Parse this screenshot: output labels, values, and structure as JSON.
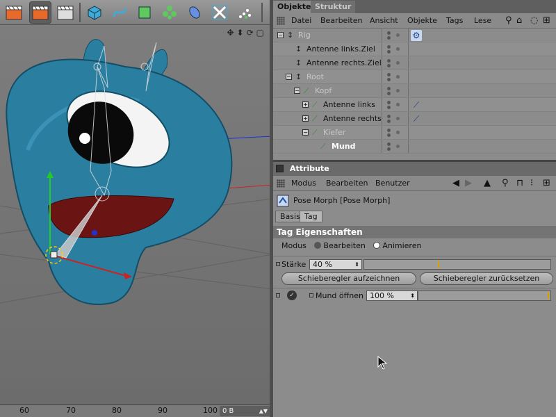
{
  "toolbar": {
    "icons": [
      "clapper-icon",
      "clapper-render-icon",
      "clapper-settings-icon",
      "cube-icon",
      "spline-icon",
      "nurbs-icon",
      "array-icon",
      "deformer-icon",
      "scene-icon",
      "particles-icon"
    ]
  },
  "timeline": {
    "ticks": [
      "60",
      "70",
      "80",
      "90",
      "100"
    ],
    "frame_value": "0 B"
  },
  "objects_panel": {
    "tabs": [
      "Objekte",
      "Struktur"
    ],
    "menu": [
      "Datei",
      "Bearbeiten",
      "Ansicht",
      "Objekte",
      "Tags",
      "Lese"
    ],
    "tree": [
      {
        "name": "Rig",
        "level": 0,
        "expander": "−",
        "style": "dim",
        "tag": "pose-morph-tag"
      },
      {
        "name": "Antenne links.Ziel",
        "level": 1,
        "expander": "",
        "style": "normal",
        "tag": ""
      },
      {
        "name": "Antenne rechts.Ziel",
        "level": 1,
        "expander": "",
        "style": "normal",
        "tag": ""
      },
      {
        "name": "Root",
        "level": 1,
        "expander": "−",
        "style": "dim",
        "tag": ""
      },
      {
        "name": "Kopf",
        "level": 2,
        "expander": "−",
        "style": "dim",
        "tag": ""
      },
      {
        "name": "Antenne links",
        "level": 3,
        "expander": "+",
        "style": "normal",
        "tag": "ik-tag"
      },
      {
        "name": "Antenne rechts",
        "level": 3,
        "expander": "+",
        "style": "normal",
        "tag": "ik-tag"
      },
      {
        "name": "Kiefer",
        "level": 3,
        "expander": "−",
        "style": "dim",
        "tag": ""
      },
      {
        "name": "Mund",
        "level": 4,
        "expander": "",
        "style": "bold",
        "tag": ""
      }
    ]
  },
  "attributes": {
    "title": "Attribute",
    "menu": [
      "Modus",
      "Bearbeiten",
      "Benutzer"
    ],
    "tag_title": "Pose Morph [Pose Morph]",
    "subtabs": [
      "Basis",
      "Tag"
    ],
    "section": "Tag Eigenschaften",
    "modus_label": "Modus",
    "mode_options": [
      "Bearbeiten",
      "Animieren"
    ],
    "selected_mode": "Animieren",
    "strength_label": "Stärke",
    "strength_value": "40 %",
    "strength_fraction": 0.4,
    "btn_record": "Schieberegler aufzeichnen",
    "btn_reset": "Schieberegler zurücksetzen",
    "morph_label": "Mund öffnen",
    "morph_value": "100 %",
    "morph_fraction": 1.0
  },
  "colors": {
    "character": "#2a7ea0",
    "panel": "#8c8c8c",
    "accent_marker": "#d8a000"
  }
}
